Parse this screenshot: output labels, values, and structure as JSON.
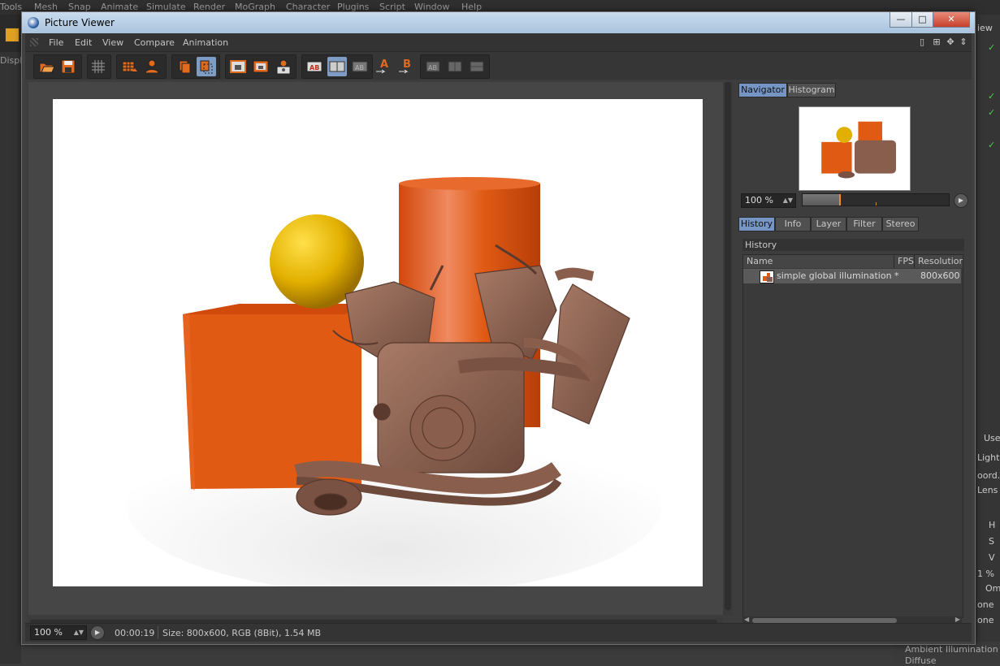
{
  "background_app": {
    "menu": [
      "Tools",
      "Mesh",
      "Snap",
      "Animate",
      "Simulate",
      "Render",
      "MoGraph",
      "Character",
      "Plugins",
      "Script",
      "Window",
      "Help"
    ],
    "left_label": "Displ",
    "right_labels": [
      "iew",
      "Use",
      "Light",
      "oord.",
      "Lens",
      "H",
      "S",
      "V",
      "1 %",
      "Om",
      "one",
      "one"
    ],
    "bottom_labels": [
      "Ambient Illumination",
      "Diffuse"
    ]
  },
  "window": {
    "title": "Picture Viewer",
    "minimize": "—",
    "maximize": "□",
    "close": "✕"
  },
  "menubar": {
    "items": [
      "File",
      "Edit",
      "View",
      "Compare",
      "Animation"
    ]
  },
  "toolbar": {
    "buttons": [
      {
        "name": "open-image",
        "icon": "folder-open-icon"
      },
      {
        "name": "save-image",
        "icon": "save-icon"
      },
      {
        "name": "render-settings",
        "icon": "grid-icon"
      },
      {
        "name": "stop-render",
        "icon": "render-stop-icon"
      },
      {
        "name": "render-region",
        "icon": "person-render-icon"
      },
      {
        "name": "ab-compare-left",
        "icon": "layers-icon"
      },
      {
        "name": "ab-compare-right",
        "icon": "layers-active-icon"
      },
      {
        "name": "view-fit",
        "icon": "monitor-fit-icon"
      },
      {
        "name": "view-full",
        "icon": "monitor-full-icon"
      },
      {
        "name": "view-team",
        "icon": "team-render-icon"
      },
      {
        "name": "compare-ab",
        "icon": "ab-icon"
      },
      {
        "name": "compare-split",
        "icon": "split-icon"
      },
      {
        "name": "compare-diff",
        "icon": "diff-icon"
      },
      {
        "name": "set-a",
        "icon": "set-a-icon",
        "label": "A"
      },
      {
        "name": "set-b",
        "icon": "set-b-icon",
        "label": "B"
      },
      {
        "name": "swap-1",
        "icon": "swap-icon"
      },
      {
        "name": "swap-2",
        "icon": "swap2-icon"
      },
      {
        "name": "swap-3",
        "icon": "swap3-icon"
      }
    ]
  },
  "navigator": {
    "tabs": [
      "Navigator",
      "Histogram"
    ],
    "active_tab": "Navigator",
    "zoom": "100 %",
    "zoom_fraction": 0.25
  },
  "history_panel": {
    "tabs": [
      "History",
      "Info",
      "Layer",
      "Filter",
      "Stereo"
    ],
    "active_tab": "History",
    "title": "History",
    "columns": [
      "Name",
      "FPS",
      "Resolutior"
    ],
    "rows": [
      {
        "name": "simple global illumination *",
        "fps": "",
        "resolution": "800x600"
      }
    ]
  },
  "status": {
    "zoom": "100 %",
    "time": "00:00:19",
    "info": "Size: 800x600, RGB (8Bit), 1.54 MB"
  },
  "colors": {
    "accent_tab": "#7596c4",
    "orange_object": "#e05a14",
    "engine": "#8a5e4c",
    "sphere": "#e8b400"
  }
}
